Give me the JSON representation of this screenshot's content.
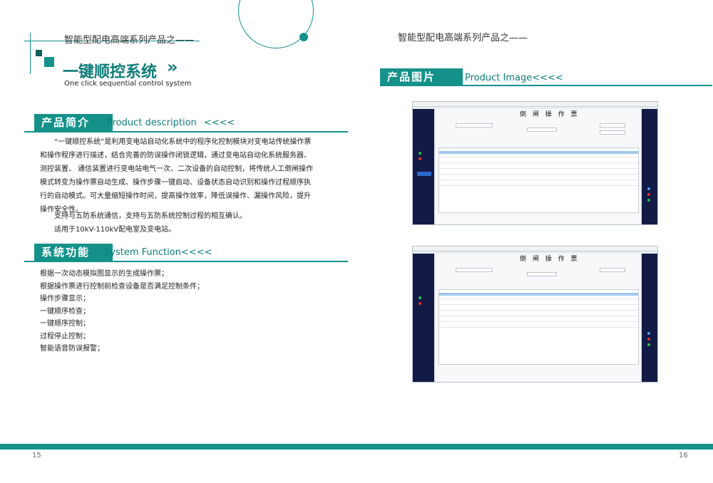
{
  "left_page": {
    "header": "智能型配电高端系列产品之——",
    "title": "一键顺控系统",
    "title_arrows": "»",
    "subtitle": "One click sequential control system",
    "intro": {
      "label": "产品简介",
      "label_en": "Product description",
      "label_arrows": "<<<<",
      "paragraphs": [
        "“一键顺控系统”是利用变电站自动化系统中的程序化控制模块对变电站传统操作票和操作程序进行描述，结合完善的防误操作闭锁逻辑，通过变电站自动化系统服务器、测控装置、 通信装置进行变电站电气一次、二次设备的自动控制，将传统人工倒闸操作模式转变为操作票自动生成、操作步骤一键启动、设备状态自动识别和操作过程顺序执行的自动模式。可大量缩短操作时间，提高操作效率，降低误操作、漏操作风险，提升操作安全性。",
        "支持与五防系统通信，支持与五防系统控制过程的相互确认。",
        "适用于10kV-110kV配电室及变电站。"
      ]
    },
    "functions": {
      "label": "系统功能",
      "label_en": "System Function",
      "label_arrows": "<<<<",
      "items": [
        "根据一次动态模拟图显示的生成操作票；",
        "根据操作票进行控制前检查设备是否满足控制条件；",
        "操作步骤显示；",
        "一键顺序检查；",
        "一键顺序控制；",
        "过程停止控制；",
        "智能语音防误报警；"
      ]
    },
    "page_number": "15"
  },
  "right_page": {
    "header": "智能型配电高端系列产品之——",
    "image_section": {
      "label": "产品图片",
      "label_en": "Product Image",
      "label_arrows": "<<<<"
    },
    "screenshots": [
      {
        "title": "倒 闸 操 作 票"
      },
      {
        "title": "倒 闸 操 作 票"
      }
    ],
    "page_number": "16"
  },
  "colors": {
    "teal": "#14928a",
    "teal_dark": "#0e7d78",
    "navy": "#121a45"
  }
}
